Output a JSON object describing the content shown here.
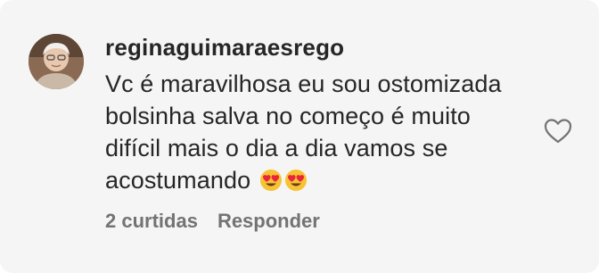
{
  "comment": {
    "username": "reginaguimaraesrego",
    "text_lines": [
      "Vc é maravilhosa eu sou ostomizada",
      "bolsinha salva no começo é muito",
      "difícil mais o dia a dia vamos se",
      "acostumando"
    ],
    "emojis": [
      "heart-eyes-emoji",
      "heart-eyes-emoji"
    ],
    "likes_label": "2 curtidas",
    "reply_label": "Responder"
  },
  "icons": {
    "like": "heart-outline-icon",
    "avatar": "user-avatar"
  },
  "colors": {
    "card_background": "#f5f5f5",
    "text_primary": "#262626",
    "text_secondary": "#737373"
  }
}
